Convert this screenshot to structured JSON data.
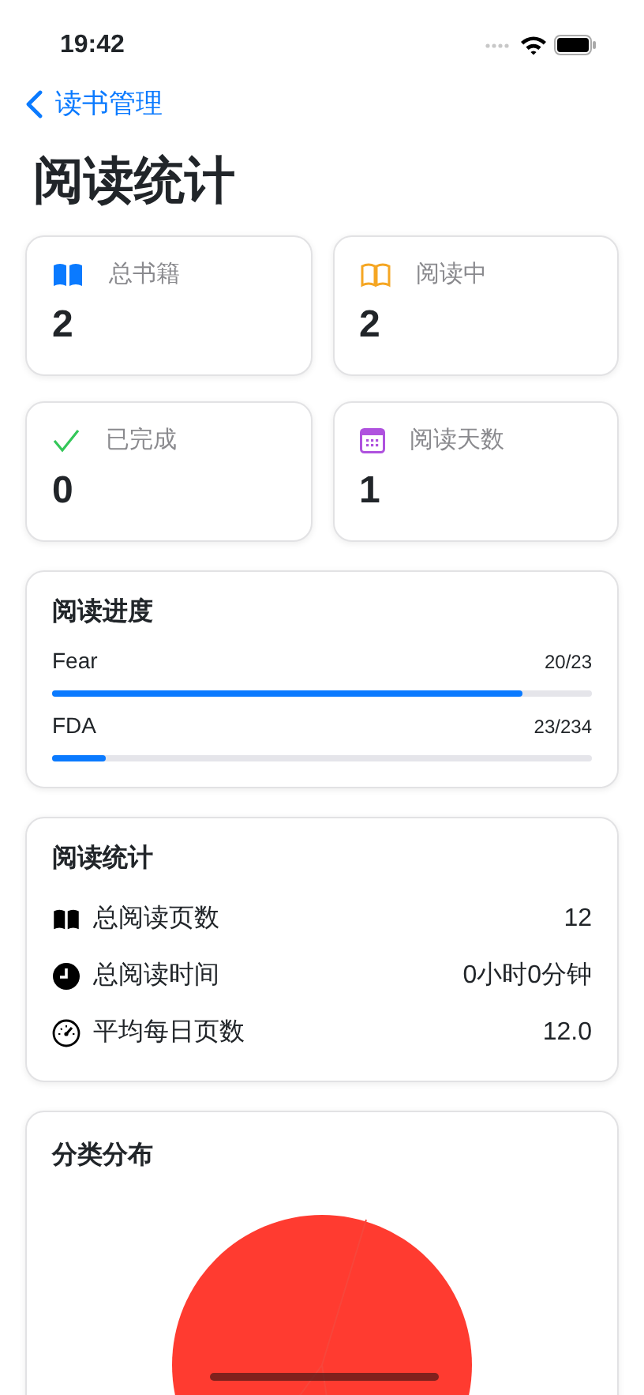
{
  "status_bar": {
    "time": "19:42"
  },
  "nav": {
    "back": "读书管理",
    "title": "阅读统计"
  },
  "summary": [
    {
      "label": "总书籍",
      "value": "2",
      "color": "#0a7aff"
    },
    {
      "label": "阅读中",
      "value": "2",
      "color": "#f5a623"
    },
    {
      "label": "已完成",
      "value": "0",
      "color": "#34c759"
    },
    {
      "label": "阅读天数",
      "value": "1",
      "color": "#af52de"
    }
  ],
  "progress": {
    "title": "阅读进度",
    "books": [
      {
        "name": "Fear",
        "reading": "20/23",
        "level": 0.87
      },
      {
        "name": "FDA",
        "reading": "23/234",
        "level": 0.098
      }
    ]
  },
  "stats": {
    "title": "阅读统计",
    "rows": [
      {
        "label": "总阅读页数",
        "value": "12"
      },
      {
        "label": "总阅读时间",
        "value": "0小时0分钟"
      },
      {
        "label": "平均每日页数",
        "value": "12.0"
      }
    ]
  },
  "category": {
    "title": "分类分布"
  }
}
